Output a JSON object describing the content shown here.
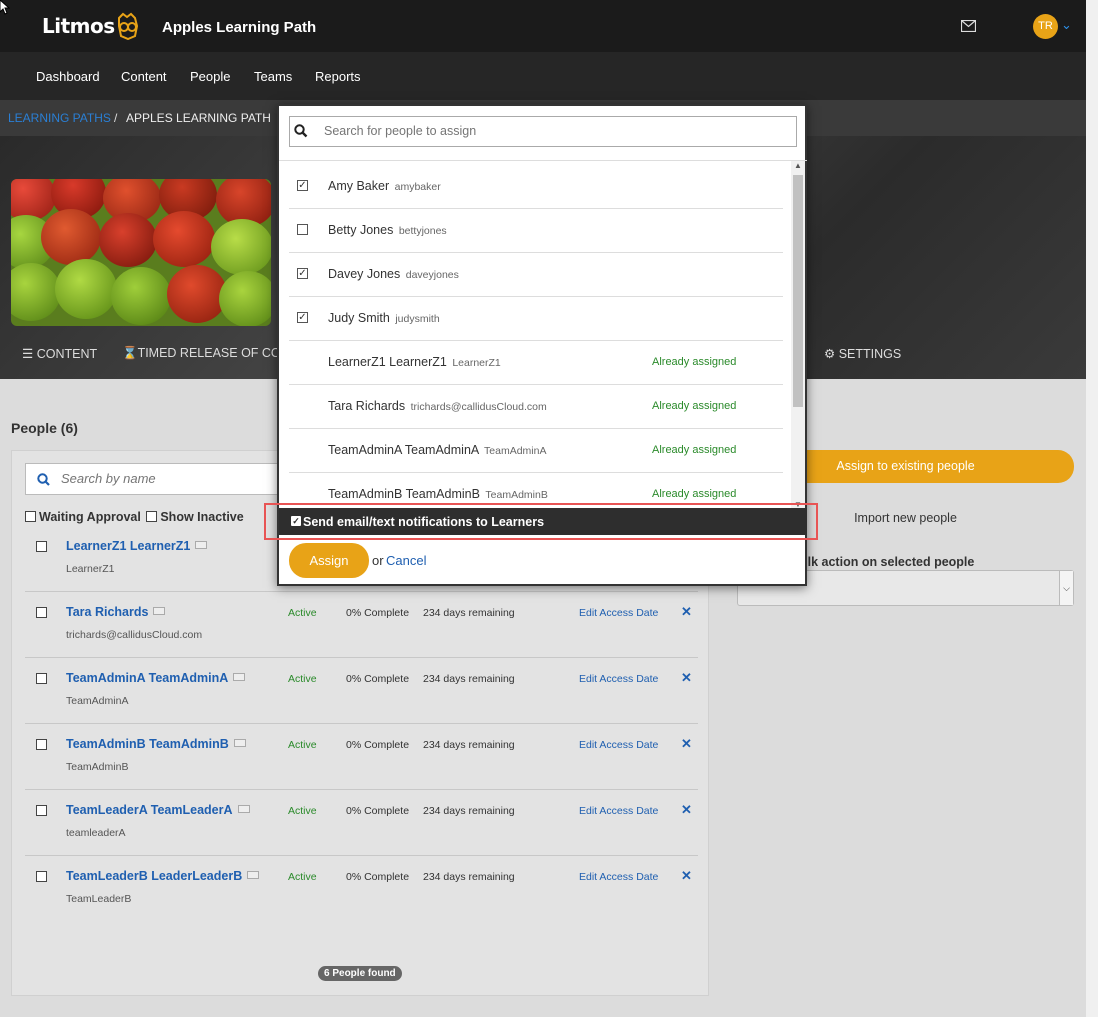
{
  "header": {
    "logo": "Litmos",
    "app_title": "Apples Learning Path",
    "avatar_initials": "TR"
  },
  "nav": {
    "items": [
      "Dashboard",
      "Content",
      "People",
      "Teams",
      "Reports"
    ]
  },
  "breadcrumb": {
    "link": "LEARNING PATHS",
    "sep": "/",
    "current": "APPLES LEARNING PATH"
  },
  "tabs": {
    "content": "CONTENT",
    "timed": "TIMED RELEASE OF COU",
    "settings": "SETTINGS"
  },
  "people": {
    "title": "People (6)",
    "search_placeholder": "Search by name",
    "filter_waiting": "Waiting Approval",
    "filter_inactive": "Show Inactive",
    "rows": [
      {
        "name": "LearnerZ1 LearnerZ1",
        "user": "LearnerZ1",
        "status": "",
        "complete": "",
        "days": "",
        "edit": "",
        "x": ""
      },
      {
        "name": "Tara Richards",
        "user": "trichards@callidusCloud.com",
        "status": "Active",
        "complete": "0% Complete",
        "days": "234 days  remaining",
        "edit": "Edit Access Date",
        "x": "✕"
      },
      {
        "name": "TeamAdminA TeamAdminA",
        "user": "TeamAdminA",
        "status": "Active",
        "complete": "0% Complete",
        "days": "234 days  remaining",
        "edit": "Edit Access Date",
        "x": "✕"
      },
      {
        "name": "TeamAdminB TeamAdminB",
        "user": "TeamAdminB",
        "status": "Active",
        "complete": "0% Complete",
        "days": "234 days  remaining",
        "edit": "Edit Access Date",
        "x": "✕"
      },
      {
        "name": "TeamLeaderA TeamLeaderA",
        "user": "teamleaderA",
        "status": "Active",
        "complete": "0% Complete",
        "days": "234 days  remaining",
        "edit": "Edit Access Date",
        "x": "✕"
      },
      {
        "name": "TeamLeaderB LeaderLeaderB",
        "user": "TeamLeaderB",
        "status": "Active",
        "complete": "0% Complete",
        "days": "234 days  remaining",
        "edit": "Edit Access Date",
        "x": "✕"
      }
    ],
    "found": "6 People found"
  },
  "right": {
    "assign_existing": "Assign to existing people",
    "import_new": "Import new people",
    "bulk_label": "ulk action on selected people"
  },
  "modal": {
    "search_placeholder": "Search for people to assign",
    "rows": [
      {
        "name": "Amy Baker",
        "user": "amybaker",
        "checked": true,
        "assigned": ""
      },
      {
        "name": "Betty Jones",
        "user": "bettyjones",
        "checked": false,
        "assigned": ""
      },
      {
        "name": "Davey Jones",
        "user": "daveyjones",
        "checked": true,
        "assigned": ""
      },
      {
        "name": "Judy Smith",
        "user": "judysmith",
        "checked": true,
        "assigned": ""
      },
      {
        "name": "LearnerZ1 LearnerZ1",
        "user": "LearnerZ1",
        "checked": null,
        "assigned": "Already assigned"
      },
      {
        "name": "Tara Richards",
        "user": "trichards@callidusCloud.com",
        "checked": null,
        "assigned": "Already assigned"
      },
      {
        "name": "TeamAdminA TeamAdminA",
        "user": "TeamAdminA",
        "checked": null,
        "assigned": "Already assigned"
      },
      {
        "name": "TeamAdminB TeamAdminB",
        "user": "TeamAdminB",
        "checked": null,
        "assigned": "Already assigned"
      }
    ],
    "notify_label": "Send email/text notifications to Learners",
    "assign_button": "Assign",
    "or": "or",
    "cancel": "Cancel"
  },
  "colors": {
    "accent": "#e8a317",
    "link": "#1f5fb0",
    "active_green": "#2a8a2a",
    "highlight": "#e85454"
  }
}
